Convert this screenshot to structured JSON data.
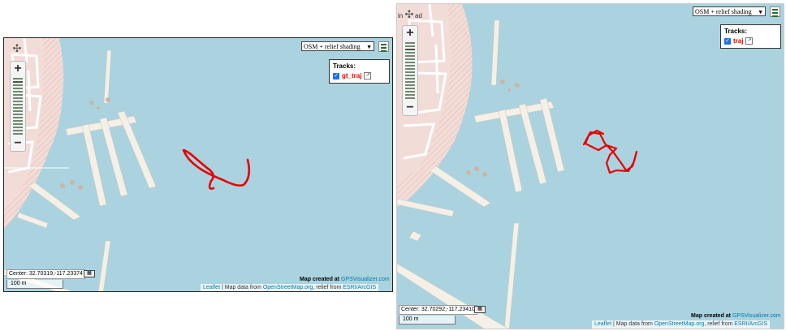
{
  "left_map": {
    "basemap_select": "OSM + relief shading",
    "tracks_title": "Tracks:",
    "track_name": "gt_traj",
    "track_checked": true,
    "track_color": "#e60000",
    "center_text": "Center: 32.70319,-117.23374",
    "scale_text": "100 m",
    "created_prefix": "Map created at",
    "created_link": "GPSVisualizer.com",
    "attr_leaflet": "Leaflet",
    "attr_sep1": " | Map data from ",
    "attr_osm": "OpenStreetMap.org",
    "attr_sep2": ", relief from ",
    "attr_esri": "ESRI/ArcGIS",
    "zoom_in": "+",
    "zoom_out": "−"
  },
  "right_map": {
    "basemap_select": "OSM + relief shading",
    "tracks_title": "Tracks:",
    "track_name": "traj",
    "track_checked": true,
    "track_color": "#e60000",
    "center_text": "Center: 32.70292,-117.23410",
    "scale_text": "100 m",
    "created_prefix": "Map created at",
    "created_link": "GPSVisualizer.com",
    "attr_leaflet": "Leaflet",
    "attr_sep1": " | Map data from ",
    "attr_osm": "OpenStreetMap.org",
    "attr_sep2": ", relief from ",
    "attr_esri": "ESRI/ArcGIS",
    "zoom_in": "+",
    "zoom_out": "−",
    "edge_label": "in",
    "edge_label2": "ad"
  },
  "colors": {
    "water": "#aad3df",
    "land": "#f2dcd8",
    "pier": "#f4f0e8",
    "track": "#e60000"
  },
  "icons": {
    "locate": "crosshair-icon",
    "layers": "hamburger-icon",
    "external": "external-link-icon",
    "calculator": "coordinate-calculator-icon"
  }
}
